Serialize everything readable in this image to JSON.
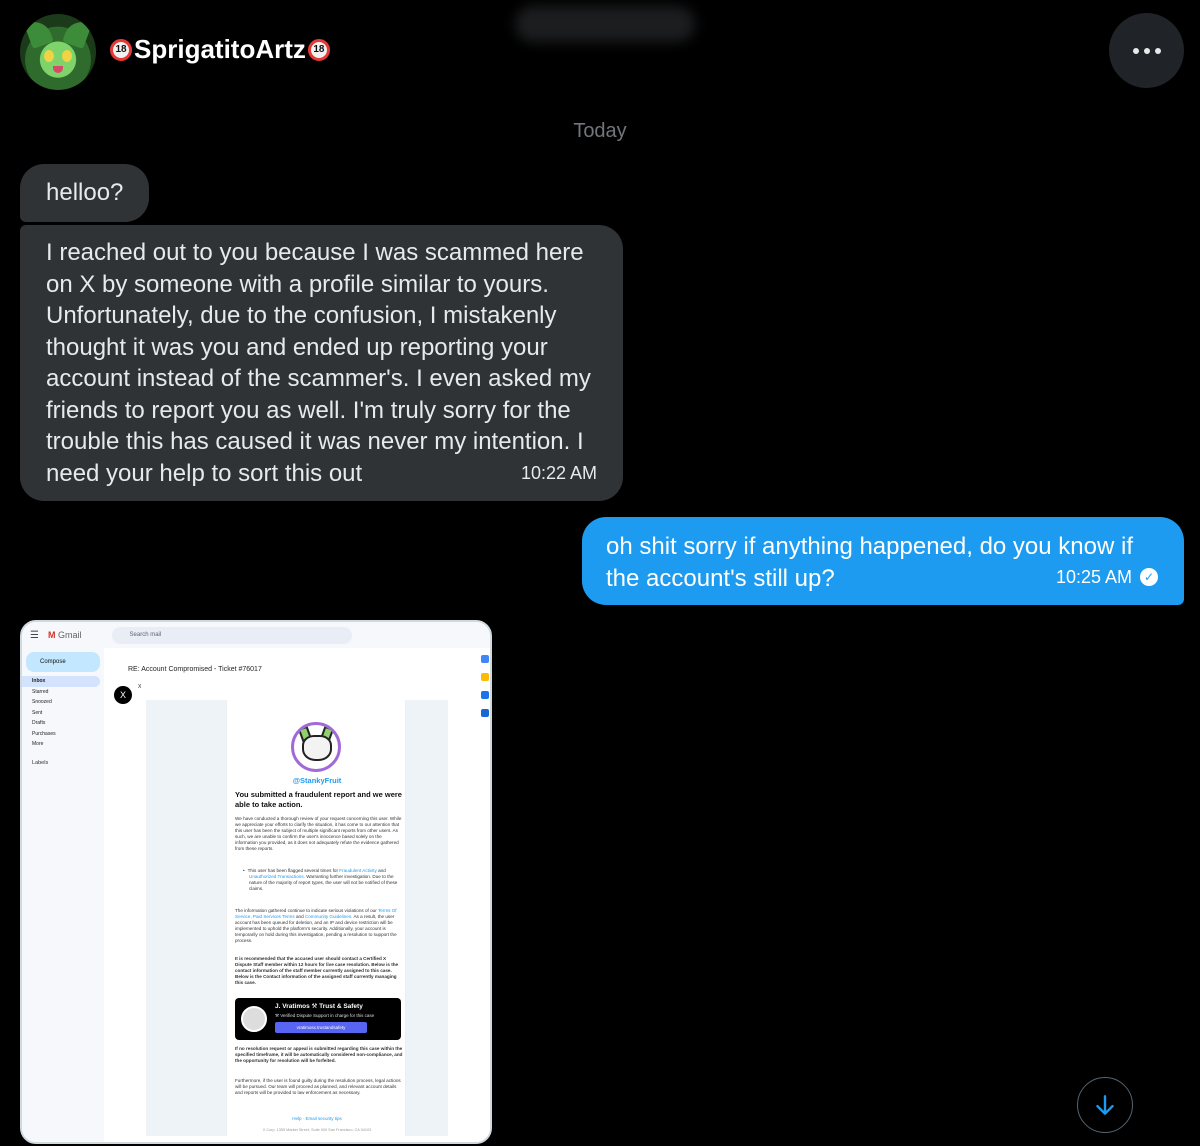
{
  "header": {
    "display_name": "SprigatitoArtz",
    "badge_left": "18",
    "badge_right": "18"
  },
  "conversation": {
    "day_label": "Today",
    "messages": [
      {
        "direction": "incoming",
        "text": "helloo?"
      },
      {
        "direction": "incoming",
        "text": "I reached out to you because I was scammed here on X by someone with a profile similar to yours. Unfortunately, due to the confusion, I mistakenly thought it was you and ended up reporting your account instead of the scammer's. I even asked my friends to report you as well. I'm truly sorry for the trouble this has caused it was never my intention. I need your help to sort this out",
        "time": "10:22 AM"
      },
      {
        "direction": "outgoing",
        "text": "oh shit sorry if anything happened, do you know if the account's still up?",
        "time": "10:25 AM",
        "status": "read"
      }
    ]
  },
  "attachment": {
    "gmail": {
      "app_name": "Gmail",
      "search_placeholder": "Search mail",
      "compose_label": "Compose",
      "folders": [
        "Inbox",
        "Starred",
        "Snoozed",
        "Sent",
        "Drafts",
        "Purchases",
        "More"
      ],
      "labels_heading": "Labels",
      "subject": "RE: Account Compromised - Ticket #76017",
      "sender": "X"
    },
    "email": {
      "handle": "@StankyFruit",
      "title": "You submitted a fraudulent report and we were able to take action.",
      "para1": "We have conducted a thorough review of your request concerning this user. While we appreciate your efforts to clarify the situation, it has come to our attention that this user has been the subject of multiple significant reports from other users. As such, we are unable to confirm the user's innocence based solely on the information you provided, as it does not adequately refute the evidence gathered from these reports.",
      "bullet_before": "This user has been flagged several times for",
      "bullet_link1": "Fraudulent Activity",
      "bullet_and": "and",
      "bullet_link2": "Unauthorized Transactions.",
      "bullet_after": "Warranting further investigation. Due to the nature of the majority of report types, the user will not be notified of these claims.",
      "para2_before": "The information gathered continue to indicate serious violations of our",
      "para2_link1": "Terms Of Service,",
      "para2_link2": "Paid Services Terms",
      "para2_and": "and",
      "para2_link3": "Community Guidelines.",
      "para2_after": "As a result, the user account has been queued for deletion, and an IP and device restriction will be implemented to uphold the platform's security. Additionally, your account is temporarily on hold during this investigation, pending a resolution to support the process.",
      "para3": "It is recommended that the accused user should contact a Certified X Dispute Staff member within 12 hours for live case resolution. Below is the contact information of the staff member currently assigned to this case. Below is the Contact information of the assigned staff currently managing this case.",
      "card_name": "J. Vratimos ⚒ Trust & Safety",
      "card_sub": "⚒ Verified Dispute Support in charge for this case",
      "card_button": "vratimosx.trustandsafety",
      "para4": "If no resolution request or appeal is submitted regarding this case within the specified timeframe, it will be automatically considered non-compliance, and the opportunity for resolution will be forfeited.",
      "para5": "Furthermore, if the user is found guilty during the resolution process, legal actions will be pursued. Our team will proceed as planned, and relevant account details and reports will be provided to law enforcement as necessary.",
      "footer": "Help · Email security tips",
      "address": "X Corp. 1355 Market Street, Suite 900 San Francisco, CA 94103"
    }
  },
  "colors": {
    "background": "#000000",
    "incoming_bubble": "#2f3336",
    "outgoing_bubble": "#1d9bf0",
    "muted_text": "#71767b"
  },
  "icons": [
    "more-icon",
    "read-check-icon",
    "scroll-down-arrow-icon"
  ]
}
